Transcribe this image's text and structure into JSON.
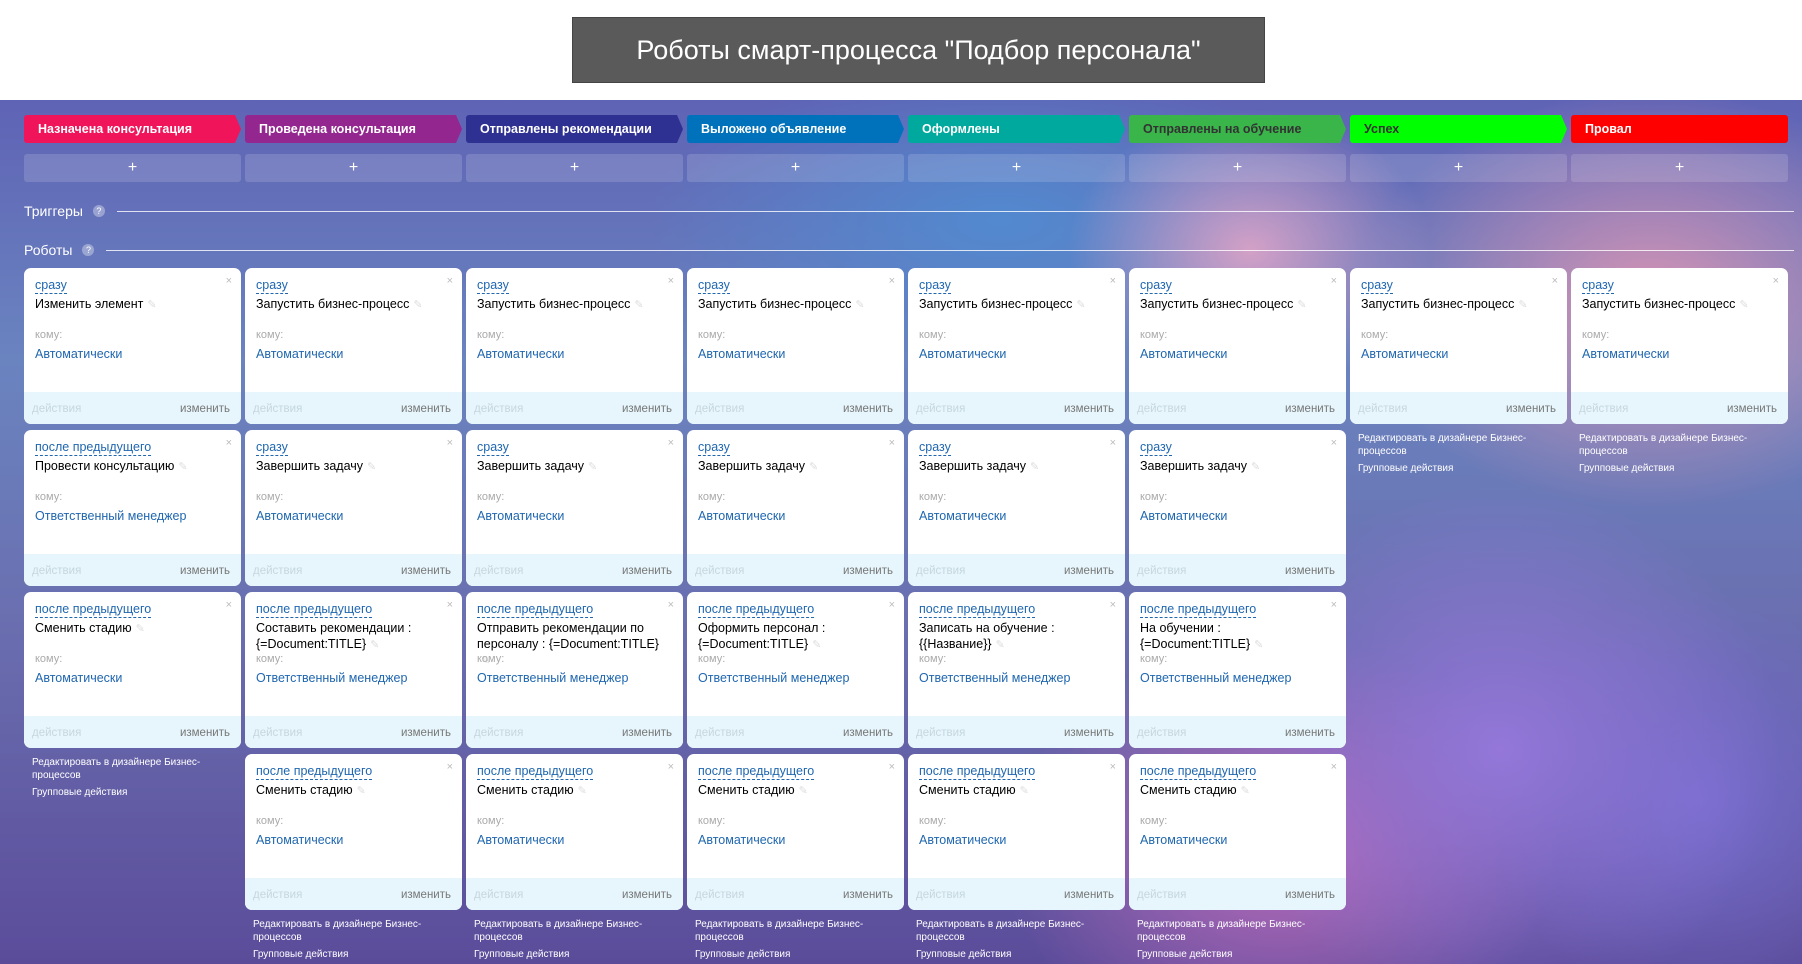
{
  "page_title": "Роботы смарт-процесса \"Подбор персонала\"",
  "triggers_label": "Триггеры",
  "robots_label": "Роботы",
  "help": "?",
  "add": "+",
  "to_label": "кому:",
  "actions_label": "действия",
  "edit_label": "изменить",
  "close": "×",
  "pen": "✎",
  "links": {
    "designer": "Редактировать в дизайнере Бизнес-процессов",
    "group": "Групповые действия"
  },
  "stages": [
    {
      "label": "Назначена консультация",
      "color": "#f0145a",
      "text": "#ffffff",
      "robots": [
        {
          "delay": "сразу",
          "name": "Изменить элемент",
          "who": "Автоматически"
        },
        {
          "delay": "после предыдущего",
          "name": "Провести консультацию",
          "who": "Ответственный менеджер"
        },
        {
          "delay": "после предыдущего",
          "name": "Сменить стадию",
          "who": "Автоматически"
        }
      ]
    },
    {
      "label": "Проведена консультация",
      "color": "#93278f",
      "text": "#ffffff",
      "robots": [
        {
          "delay": "сразу",
          "name": "Запустить бизнес-процесс",
          "who": "Автоматически"
        },
        {
          "delay": "сразу",
          "name": "Завершить задачу",
          "who": "Автоматически"
        },
        {
          "delay": "после предыдущего",
          "name": "Составить рекомендации : {=Document:TITLE}",
          "who": "Ответственный менеджер"
        },
        {
          "delay": "после предыдущего",
          "name": "Сменить стадию",
          "who": "Автоматически"
        }
      ]
    },
    {
      "label": "Отправлены рекомендации",
      "color": "#2e3192",
      "text": "#ffffff",
      "robots": [
        {
          "delay": "сразу",
          "name": "Запустить бизнес-процесс",
          "who": "Автоматически"
        },
        {
          "delay": "сразу",
          "name": "Завершить задачу",
          "who": "Автоматически"
        },
        {
          "delay": "после предыдущего",
          "name": "Отправить рекомендации по персоналу : {=Document:TITLE}",
          "who": "Ответственный менеджер"
        },
        {
          "delay": "после предыдущего",
          "name": "Сменить стадию",
          "who": "Автоматически"
        }
      ]
    },
    {
      "label": "Выложено объявление",
      "color": "#0072bc",
      "text": "#ffffff",
      "robots": [
        {
          "delay": "сразу",
          "name": "Запустить бизнес-процесс",
          "who": "Автоматически"
        },
        {
          "delay": "сразу",
          "name": "Завершить задачу",
          "who": "Автоматически"
        },
        {
          "delay": "после предыдущего",
          "name": "Оформить персонал : {=Document:TITLE}",
          "who": "Ответственный менеджер"
        },
        {
          "delay": "после предыдущего",
          "name": "Сменить стадию",
          "who": "Автоматически"
        }
      ]
    },
    {
      "label": "Оформлены",
      "color": "#00a99d",
      "text": "#ffffff",
      "robots": [
        {
          "delay": "сразу",
          "name": "Запустить бизнес-процесс",
          "who": "Автоматически"
        },
        {
          "delay": "сразу",
          "name": "Завершить задачу",
          "who": "Автоматически"
        },
        {
          "delay": "после предыдущего",
          "name": "Записать на обучение : {{Название}}",
          "who": "Ответственный менеджер"
        },
        {
          "delay": "после предыдущего",
          "name": "Сменить стадию",
          "who": "Автоматически"
        }
      ]
    },
    {
      "label": "Отправлены на обучение",
      "color": "#39b54a",
      "text": "#333333",
      "robots": [
        {
          "delay": "сразу",
          "name": "Запустить бизнес-процесс",
          "who": "Автоматически"
        },
        {
          "delay": "сразу",
          "name": "Завершить задачу",
          "who": "Автоматически"
        },
        {
          "delay": "после предыдущего",
          "name": "На обучении : {=Document:TITLE}",
          "who": "Ответственный менеджер"
        },
        {
          "delay": "после предыдущего",
          "name": "Сменить стадию",
          "who": "Автоматически"
        }
      ]
    },
    {
      "label": "Успех",
      "color": "#00ff00",
      "text": "#333333",
      "robots": [
        {
          "delay": "сразу",
          "name": "Запустить бизнес-процесс",
          "who": "Автоматически"
        }
      ]
    },
    {
      "label": "Провал",
      "color": "#ff0000",
      "text": "#ffffff",
      "robots": [
        {
          "delay": "сразу",
          "name": "Запустить бизнес-процесс",
          "who": "Автоматически"
        }
      ]
    }
  ]
}
